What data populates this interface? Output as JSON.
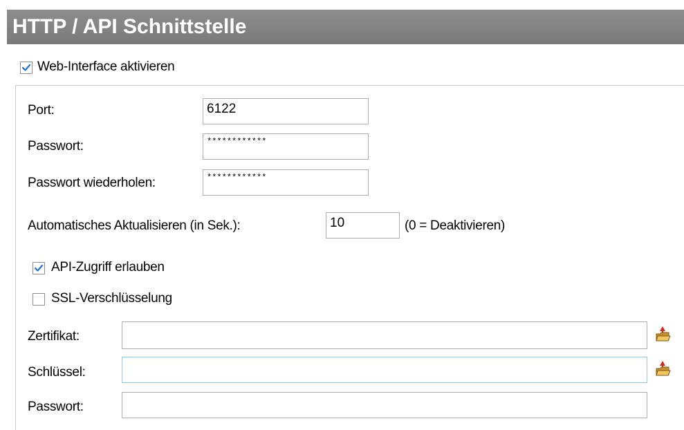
{
  "header": {
    "title": "HTTP / API Schnittstelle"
  },
  "web_interface": {
    "label": "Web-Interface aktivieren",
    "checked": true
  },
  "port": {
    "label": "Port:",
    "value": "6122"
  },
  "password": {
    "label": "Passwort:",
    "value": "************"
  },
  "password_repeat": {
    "label": "Passwort wiederholen:",
    "value": "************"
  },
  "auto_refresh": {
    "label": "Automatisches Aktualisieren (in Sek.):",
    "value": "10",
    "hint": "(0 = Deaktivieren)"
  },
  "api_access": {
    "label": "API-Zugriff erlauben",
    "checked": true
  },
  "ssl": {
    "label": "SSL-Verschlüsselung",
    "checked": false
  },
  "certificate": {
    "label": "Zertifikat:",
    "value": "",
    "browse_icon": "open-folder-icon"
  },
  "key": {
    "label": "Schlüssel:",
    "value": "",
    "browse_icon": "open-folder-icon"
  },
  "ssl_password": {
    "label": "Passwort:",
    "value": ""
  },
  "colors": {
    "header_bg": "#858585",
    "header_text": "#ffffff",
    "check_mark": "#1e6fcf",
    "focus_border": "#8bc6ef"
  }
}
